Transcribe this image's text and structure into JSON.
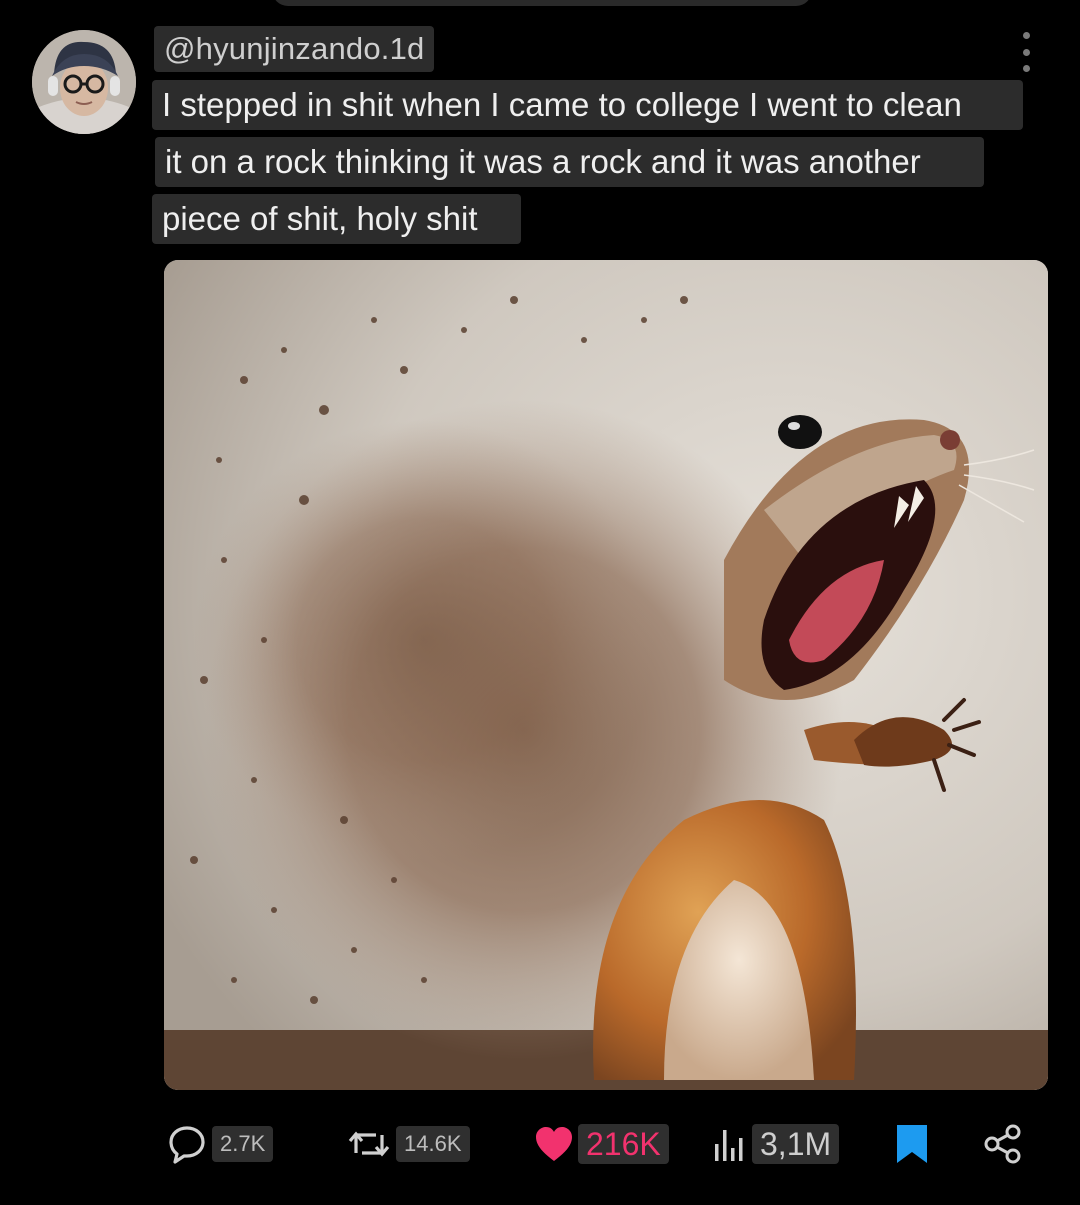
{
  "post": {
    "handle": "@hyunjinzando.1d",
    "text_lines": [
      "I stepped in shit when I came to college I went to clean",
      "it on a rock thinking it was a rock and it was another",
      "piece of shit, holy shit"
    ]
  },
  "media": {
    "icon": "squirrel-disintegrating-image"
  },
  "actions": {
    "reply_count": "2.7K",
    "repost_count": "14.6K",
    "like_count": "216K",
    "view_count": "3,1M"
  },
  "icons": {
    "reply": "speech-bubble-icon",
    "repost": "repost-arrows-icon",
    "like": "heart-icon",
    "views": "bar-chart-icon",
    "bookmark": "bookmark-icon",
    "share": "share-icon",
    "more": "more-vertical-icon"
  },
  "colors": {
    "background": "#000000",
    "like_pink": "#f2326e",
    "bookmark_blue": "#1d9bf0",
    "text_box": "#2c2c2c"
  }
}
